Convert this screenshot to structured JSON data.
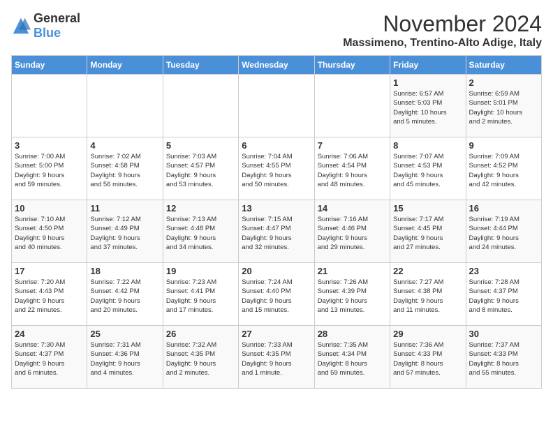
{
  "logo": {
    "general": "General",
    "blue": "Blue"
  },
  "title": "November 2024",
  "location": "Massimeno, Trentino-Alto Adige, Italy",
  "headers": [
    "Sunday",
    "Monday",
    "Tuesday",
    "Wednesday",
    "Thursday",
    "Friday",
    "Saturday"
  ],
  "rows": [
    [
      {
        "day": "",
        "text": ""
      },
      {
        "day": "",
        "text": ""
      },
      {
        "day": "",
        "text": ""
      },
      {
        "day": "",
        "text": ""
      },
      {
        "day": "",
        "text": ""
      },
      {
        "day": "1",
        "text": "Sunrise: 6:57 AM\nSunset: 5:03 PM\nDaylight: 10 hours\nand 5 minutes."
      },
      {
        "day": "2",
        "text": "Sunrise: 6:59 AM\nSunset: 5:01 PM\nDaylight: 10 hours\nand 2 minutes."
      }
    ],
    [
      {
        "day": "3",
        "text": "Sunrise: 7:00 AM\nSunset: 5:00 PM\nDaylight: 9 hours\nand 59 minutes."
      },
      {
        "day": "4",
        "text": "Sunrise: 7:02 AM\nSunset: 4:58 PM\nDaylight: 9 hours\nand 56 minutes."
      },
      {
        "day": "5",
        "text": "Sunrise: 7:03 AM\nSunset: 4:57 PM\nDaylight: 9 hours\nand 53 minutes."
      },
      {
        "day": "6",
        "text": "Sunrise: 7:04 AM\nSunset: 4:55 PM\nDaylight: 9 hours\nand 50 minutes."
      },
      {
        "day": "7",
        "text": "Sunrise: 7:06 AM\nSunset: 4:54 PM\nDaylight: 9 hours\nand 48 minutes."
      },
      {
        "day": "8",
        "text": "Sunrise: 7:07 AM\nSunset: 4:53 PM\nDaylight: 9 hours\nand 45 minutes."
      },
      {
        "day": "9",
        "text": "Sunrise: 7:09 AM\nSunset: 4:52 PM\nDaylight: 9 hours\nand 42 minutes."
      }
    ],
    [
      {
        "day": "10",
        "text": "Sunrise: 7:10 AM\nSunset: 4:50 PM\nDaylight: 9 hours\nand 40 minutes."
      },
      {
        "day": "11",
        "text": "Sunrise: 7:12 AM\nSunset: 4:49 PM\nDaylight: 9 hours\nand 37 minutes."
      },
      {
        "day": "12",
        "text": "Sunrise: 7:13 AM\nSunset: 4:48 PM\nDaylight: 9 hours\nand 34 minutes."
      },
      {
        "day": "13",
        "text": "Sunrise: 7:15 AM\nSunset: 4:47 PM\nDaylight: 9 hours\nand 32 minutes."
      },
      {
        "day": "14",
        "text": "Sunrise: 7:16 AM\nSunset: 4:46 PM\nDaylight: 9 hours\nand 29 minutes."
      },
      {
        "day": "15",
        "text": "Sunrise: 7:17 AM\nSunset: 4:45 PM\nDaylight: 9 hours\nand 27 minutes."
      },
      {
        "day": "16",
        "text": "Sunrise: 7:19 AM\nSunset: 4:44 PM\nDaylight: 9 hours\nand 24 minutes."
      }
    ],
    [
      {
        "day": "17",
        "text": "Sunrise: 7:20 AM\nSunset: 4:43 PM\nDaylight: 9 hours\nand 22 minutes."
      },
      {
        "day": "18",
        "text": "Sunrise: 7:22 AM\nSunset: 4:42 PM\nDaylight: 9 hours\nand 20 minutes."
      },
      {
        "day": "19",
        "text": "Sunrise: 7:23 AM\nSunset: 4:41 PM\nDaylight: 9 hours\nand 17 minutes."
      },
      {
        "day": "20",
        "text": "Sunrise: 7:24 AM\nSunset: 4:40 PM\nDaylight: 9 hours\nand 15 minutes."
      },
      {
        "day": "21",
        "text": "Sunrise: 7:26 AM\nSunset: 4:39 PM\nDaylight: 9 hours\nand 13 minutes."
      },
      {
        "day": "22",
        "text": "Sunrise: 7:27 AM\nSunset: 4:38 PM\nDaylight: 9 hours\nand 11 minutes."
      },
      {
        "day": "23",
        "text": "Sunrise: 7:28 AM\nSunset: 4:37 PM\nDaylight: 9 hours\nand 8 minutes."
      }
    ],
    [
      {
        "day": "24",
        "text": "Sunrise: 7:30 AM\nSunset: 4:37 PM\nDaylight: 9 hours\nand 6 minutes."
      },
      {
        "day": "25",
        "text": "Sunrise: 7:31 AM\nSunset: 4:36 PM\nDaylight: 9 hours\nand 4 minutes."
      },
      {
        "day": "26",
        "text": "Sunrise: 7:32 AM\nSunset: 4:35 PM\nDaylight: 9 hours\nand 2 minutes."
      },
      {
        "day": "27",
        "text": "Sunrise: 7:33 AM\nSunset: 4:35 PM\nDaylight: 9 hours\nand 1 minute."
      },
      {
        "day": "28",
        "text": "Sunrise: 7:35 AM\nSunset: 4:34 PM\nDaylight: 8 hours\nand 59 minutes."
      },
      {
        "day": "29",
        "text": "Sunrise: 7:36 AM\nSunset: 4:33 PM\nDaylight: 8 hours\nand 57 minutes."
      },
      {
        "day": "30",
        "text": "Sunrise: 7:37 AM\nSunset: 4:33 PM\nDaylight: 8 hours\nand 55 minutes."
      }
    ]
  ]
}
